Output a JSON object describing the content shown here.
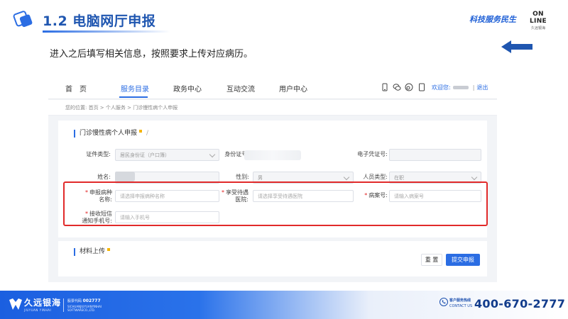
{
  "slide": {
    "title": "1.2 电脑网厅申报",
    "slogan": "科技服务民生",
    "online_logo": "ON LINE",
    "online_sub": "久远银海",
    "instruction": "进入之后填写相关信息，按照要求上传对应病历。"
  },
  "app": {
    "nav": {
      "items": [
        "首　页",
        "服务目录",
        "政务中心",
        "互动交流",
        "用户中心"
      ],
      "active_index": 1,
      "welcome_prefix": "欢迎您:",
      "logout": "退出"
    },
    "breadcrumb": "您的位置:  首页  >  个人服务  >  门诊慢性病个人申报",
    "form": {
      "section_title": "门诊慢性病个人申报",
      "section_slash": "/",
      "row1": {
        "id_type_label": "证件类型:",
        "id_type_value": "居民身份证（户口簿）",
        "id_number_label": "身份证号:",
        "e_cert_label": "电子凭证号:"
      },
      "row2": {
        "name_label": "姓名:",
        "gender_label": "性别:",
        "gender_value": "男",
        "person_type_label": "人员类型:",
        "person_type_value": "在职"
      },
      "row3": {
        "disease_label_1": "申报病种",
        "disease_label_2": "名称:",
        "disease_placeholder": "请选择申报病种名称",
        "hospital_label_1": "享受待遇",
        "hospital_label_2": "医院:",
        "hospital_placeholder": "请选择享受待遇医院",
        "case_label": "病案号:",
        "case_placeholder": "请输入病案号"
      },
      "row4": {
        "phone_label_1": "接收短信",
        "phone_label_2": "通知手机号:",
        "phone_placeholder": "请输入手机号"
      }
    },
    "upload": {
      "section_title": "材料上传"
    },
    "buttons": {
      "reset": "重 置",
      "submit": "提交申报"
    }
  },
  "footer": {
    "brand_name": "久远银海",
    "brand_en": "JIUYUAN YINHAI",
    "stock_label": "股票代码",
    "stock_code": "002777",
    "company_en": "SICHUANJIUYUANYINHAI SOFTWARECO.,LTD.",
    "hotline_cn": "客户服务热线",
    "hotline_en": "CONTACT US",
    "hotline_number": "400-670-2777"
  },
  "colors": {
    "brand_blue": "#2b6de3",
    "title_blue": "#1f56b0",
    "highlight_red": "#e12a2a"
  }
}
